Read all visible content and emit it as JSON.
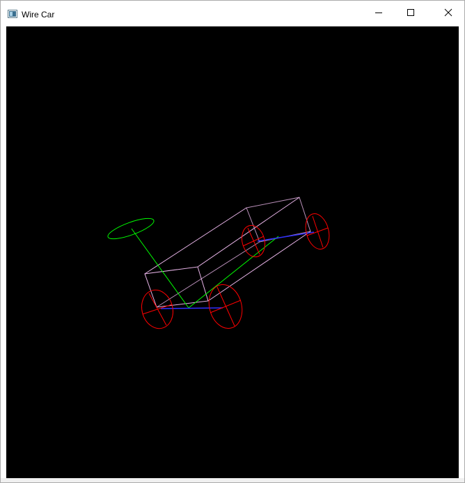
{
  "window": {
    "title": "Wire Car",
    "icon": "app-window-icon",
    "controls": {
      "minimize": "minimize-icon",
      "maximize": "maximize-icon",
      "close": "close-icon"
    }
  },
  "canvas": {
    "background": "#000000",
    "colors": {
      "body": "#e8b4e8",
      "wheels": "#ff0000",
      "axles": "#3030ff",
      "steering": "#00ff00"
    }
  }
}
